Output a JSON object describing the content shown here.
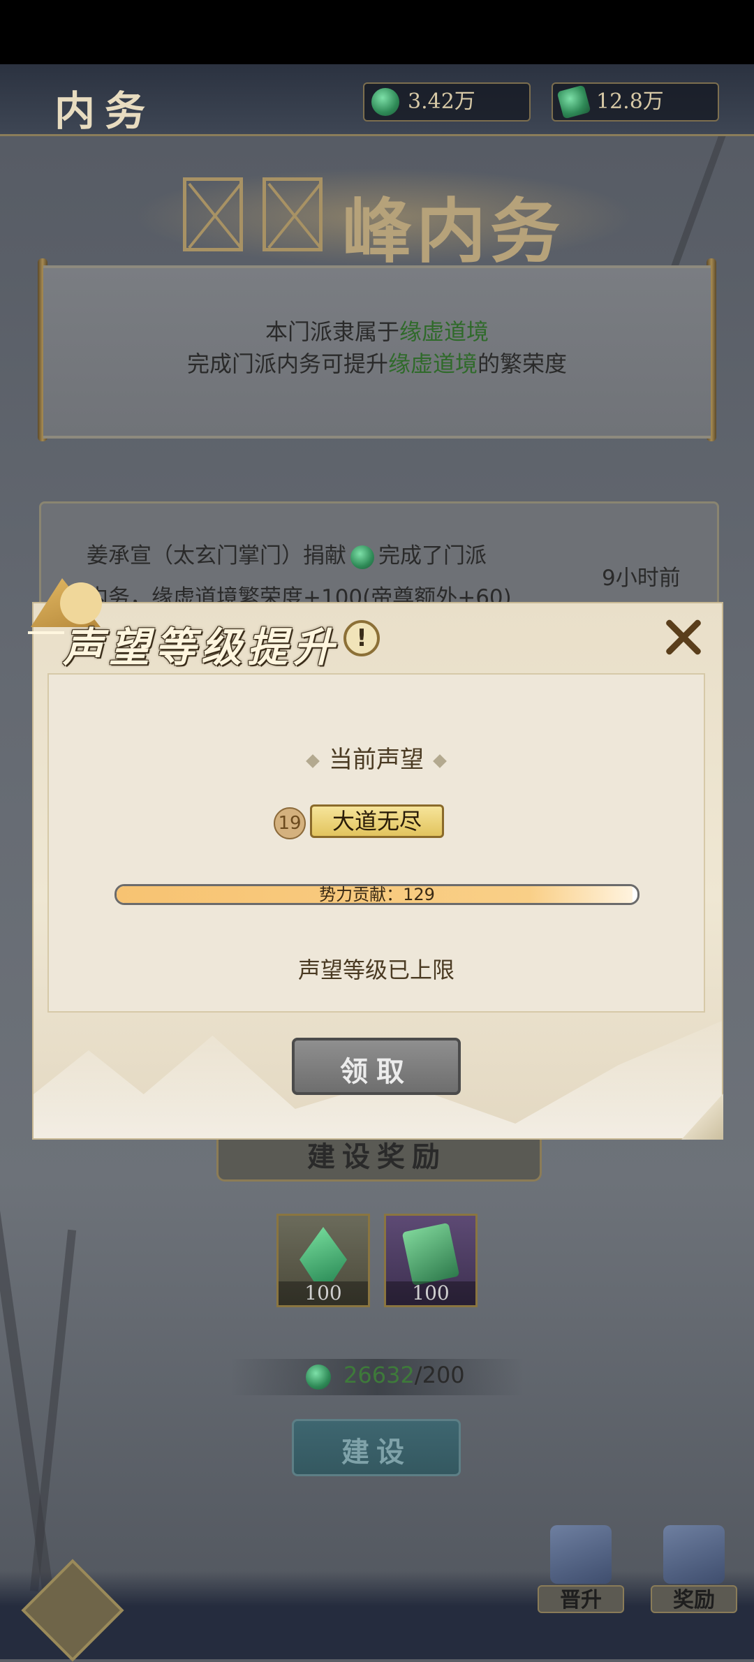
{
  "header": {
    "title": "内务",
    "currencies": [
      {
        "icon": "jade-coin-icon",
        "value": "3.42万"
      },
      {
        "icon": "jade-token-icon",
        "value": "12.8万"
      }
    ]
  },
  "banner": {
    "title_tail": "峰内务"
  },
  "scroll_info": {
    "line1_prefix": "本门派隶属于",
    "line1_highlight": "缘虚道境",
    "line2_prefix": "完成门派内务可提升",
    "line2_highlight": "缘虚道境",
    "line2_suffix": "的繁荣度"
  },
  "log": {
    "line1_before": "姜承宣（太玄门掌门）捐献",
    "line1_after": "完成了门派",
    "line2": "内务，缘虚道境繁荣度+100(帝尊额外+60)",
    "time": "9小时前"
  },
  "construction": {
    "title": "建设奖励",
    "items": [
      {
        "icon": "jade-crystal-icon",
        "count": "100"
      },
      {
        "icon": "jade-talisman-icon",
        "count": "100"
      }
    ],
    "cost_have": "26632",
    "cost_need": "/200",
    "build_label": "建设"
  },
  "nav": {
    "promote": "晋升",
    "reward": "奖励"
  },
  "modal": {
    "title": "声望等级提升",
    "info_icon": "!",
    "current_label": "当前声望",
    "level": "19",
    "rank": "大道无尽",
    "progress_text": "势力贡献：129",
    "progress": 0.99,
    "max_text": "声望等级已上限",
    "claim_label": "领取"
  },
  "colors": {
    "highlight_green": "#2f6a2a",
    "progress_fill": "#f9cf87"
  }
}
